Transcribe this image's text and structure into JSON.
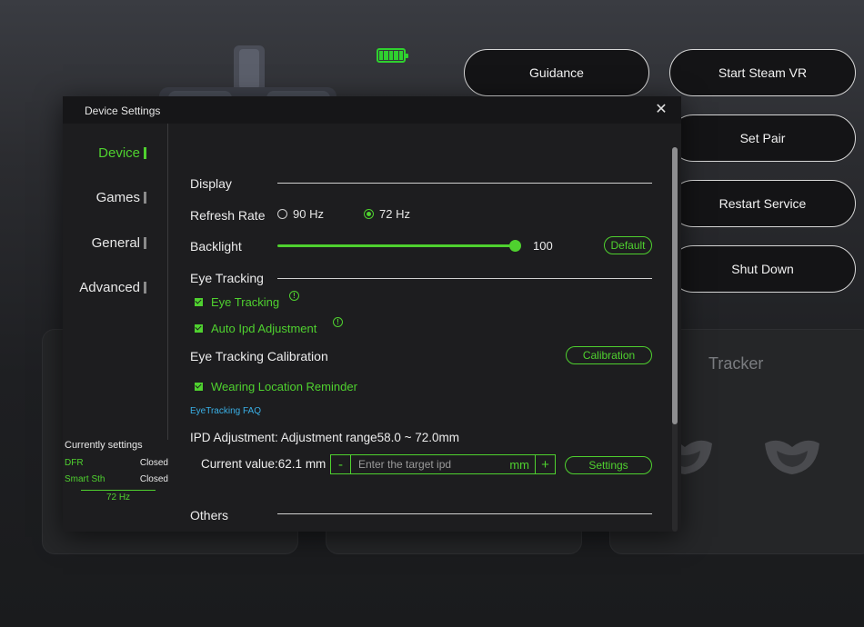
{
  "background": {
    "buttons": {
      "guidance": "Guidance",
      "start_steam_vr": "Start Steam VR",
      "set_pair": "Set Pair",
      "restart_service": "Restart Service",
      "shut_down": "Shut Down"
    },
    "tracker_title": "Tracker",
    "battery_level_fraction": 1.0
  },
  "dialog": {
    "title": "Device Settings",
    "nav": [
      {
        "label": "Device",
        "active": true
      },
      {
        "label": "Games",
        "active": false
      },
      {
        "label": "General",
        "active": false
      },
      {
        "label": "Advanced",
        "active": false
      }
    ],
    "current_settings": {
      "title": "Currently settings",
      "dfr_label": "DFR",
      "dfr_value": "Closed",
      "smart_label": "Smart Sth",
      "smart_value": "Closed",
      "refresh": "72 Hz"
    },
    "display": {
      "section": "Display",
      "refresh_rate_label": "Refresh Rate",
      "option_90": "90 Hz",
      "option_72": "72 Hz",
      "selected": "72 Hz",
      "backlight_label": "Backlight",
      "backlight_value": "100",
      "backlight_fraction": 1.0,
      "default_button": "Default"
    },
    "eye_tracking": {
      "section": "Eye Tracking",
      "eye_tracking_check": "Eye Tracking",
      "auto_ipd_check": "Auto Ipd Adjustment",
      "calibration_label": "Eye Tracking Calibration",
      "calibration_button": "Calibration",
      "wearing_reminder_check": "Wearing Location Reminder",
      "faq_link": "EyeTracking FAQ",
      "ipd_label": "IPD Adjustment: Adjustment range58.0 ~ 72.0mm",
      "current_value_label": "Current value:62.1 mm",
      "ipd_placeholder": "Enter the target ipd",
      "minus": "-",
      "plus": "+",
      "unit": "mm",
      "settings_button": "Settings"
    },
    "others": {
      "section": "Others"
    }
  },
  "colors": {
    "accent": "#4fd12f",
    "link": "#3ab0e6",
    "dialog_bg": "#1d1d1f"
  }
}
